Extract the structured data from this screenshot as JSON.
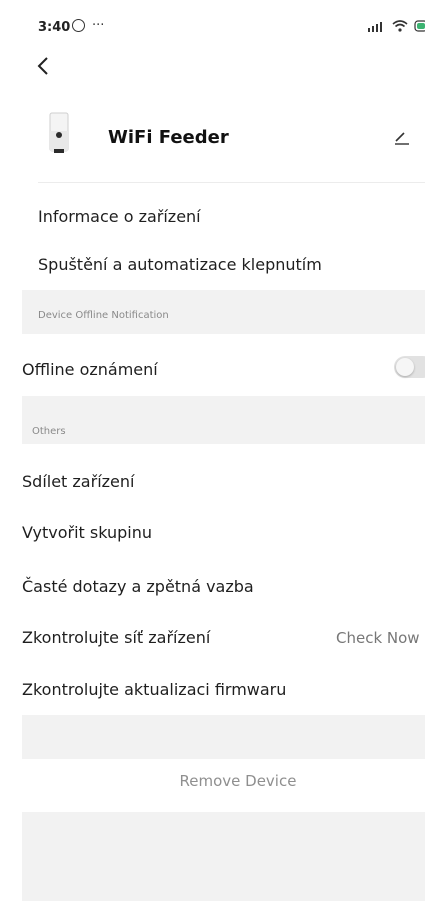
{
  "status_bar": {
    "time": "3:40",
    "dots": "···"
  },
  "device": {
    "name": "WiFi Feeder"
  },
  "menu": {
    "device_info": "Informace o zařízení",
    "tap_to_run": "Spuštění a automatizace klepnutím"
  },
  "offline_section": {
    "label": "Device Offline Notification",
    "item": "Offline oznámení",
    "toggle_on": false
  },
  "others_section": {
    "label": "Others",
    "share": "Sdílet zařízení",
    "create_group": "Vytvořit skupinu",
    "faq": "Časté dotazy a zpětná vazba",
    "check_network": "Zkontrolujte síť zařízení",
    "check_now": "Check Now",
    "check_firmware": "Zkontrolujte aktualizaci firmwaru"
  },
  "remove_button": "Remove Device",
  "icons": {
    "back": "back-arrow-icon",
    "edit": "edit-pencil-icon",
    "wifi": "wifi-icon",
    "signal": "signal-icon",
    "battery": "battery-icon",
    "status_app": "app-notification-icon"
  }
}
